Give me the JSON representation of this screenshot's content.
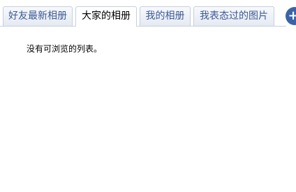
{
  "tabs": [
    {
      "label": "好友最新相册",
      "active": false
    },
    {
      "label": "大家的相册",
      "active": true
    },
    {
      "label": "我的相册",
      "active": false
    },
    {
      "label": "我表态过的图片",
      "active": false
    }
  ],
  "add_button": {
    "icon": "plus-icon",
    "glyph": "+"
  },
  "content": {
    "empty_message": "没有可浏览的列表。"
  },
  "colors": {
    "tab_text": "#3b5998",
    "tab_border": "#c6cfdd",
    "add_button_bg": "#3b64a8"
  }
}
